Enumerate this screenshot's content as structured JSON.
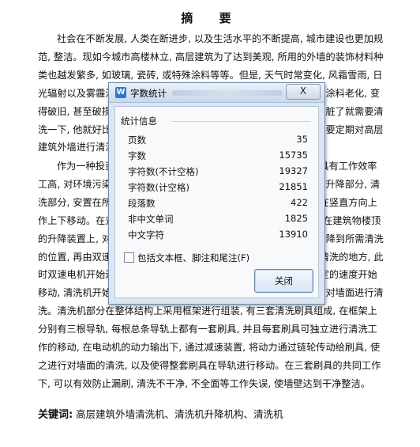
{
  "document": {
    "title": "摘  要",
    "para1": "社会在不断发展, 人类在断进步, 以及生活水平的不断提高, 城市建设也更加规范, 整洁。现如今城市高楼林立, 高层建筑为了达到美观, 所用的外墙的装饰材料种类也越发繁多, 如玻璃, 瓷砖, 或特殊涂料等等。但是, 天气时常变化, 风霜雪雨, 日光辐射以及雾霾污染, 沙尘暴等, 都会使外墙变得脏乱不堪, 甚至会使涂料老化, 变得破旧, 甚至破损, 不再如当初般漂亮美观。就好比人穿的衣服一样, 脏了就需要清洗一下, 他就好比人身上的衣服, 要保持城市建筑物外墙的清洁, 就需要定期对高层建筑外墙进行清洗, 整理, 以及日常维护保养。",
    "para2": "作为一种投资少, 见效快的外墙清洗设备, 高层建筑外墙清洗机具有工作效率工高, 对环境污染小, 节约用水, 安全可靠等诸多优点。本设计主要由升降部分, 清洗部分, 安置在所清洗的高层建筑顶部的升降机构, 可以使其沿外墙在竖直方向上作上下移动。在对建筑外墙进行清洗工作前, 清洗机通过钢丝绳悬挂在建筑物楼顶的升降装置上, 对升降部分进行固定; 然后启动升降机构, 使清洗机下降到所需清洗的位置, 再由双速电机进行高速传输动力, 使清洗机快速移动到所要清洗的地方, 此时双速电机开始进行反向动力的输出, 机架在电动机的带动下, 以一定的速度开始移动, 清洗机开始向下移动, 清洗机供水系统向刷具供水, 各刷具开始对墙面进行清洗。清洗机部分在整体结构上采用框架进行组装, 有三套清洗刷具组成, 在框架上分别有三根导轨, 每根总条导轨上都有一套刷具, 并且每套刷具可独立进行清洗工作的移动, 在电动机的动力输出下, 通过减速装置, 将动力通过链轮传动给刷具, 使之进行对墙面的清洗, 以及使得整套刷具在导轨进行移动。在三套刷具的共同工作下, 可以有效防止漏刷, 清洗不干净, 不全面等工作失误, 使墙壁达到干净整洁。",
    "keywords_label": "关键词:",
    "keywords": " 高层建筑外墙清洗机、清洗机升降机构、清洗机"
  },
  "dialog": {
    "title": "字数统计",
    "close_label": "X",
    "group_label": "统计信息",
    "stats": [
      {
        "label": "页数",
        "value": "35"
      },
      {
        "label": "字数",
        "value": "15735"
      },
      {
        "label": "字符数(不计空格)",
        "value": "19327"
      },
      {
        "label": "字符数(计空格)",
        "value": "21851"
      },
      {
        "label": "段落数",
        "value": "422"
      },
      {
        "label": "非中文单词",
        "value": "1825"
      },
      {
        "label": "中文字符",
        "value": "13910"
      }
    ],
    "checkbox_label": "包括文本框、脚注和尾注(F)",
    "ok_label": "关闭"
  }
}
